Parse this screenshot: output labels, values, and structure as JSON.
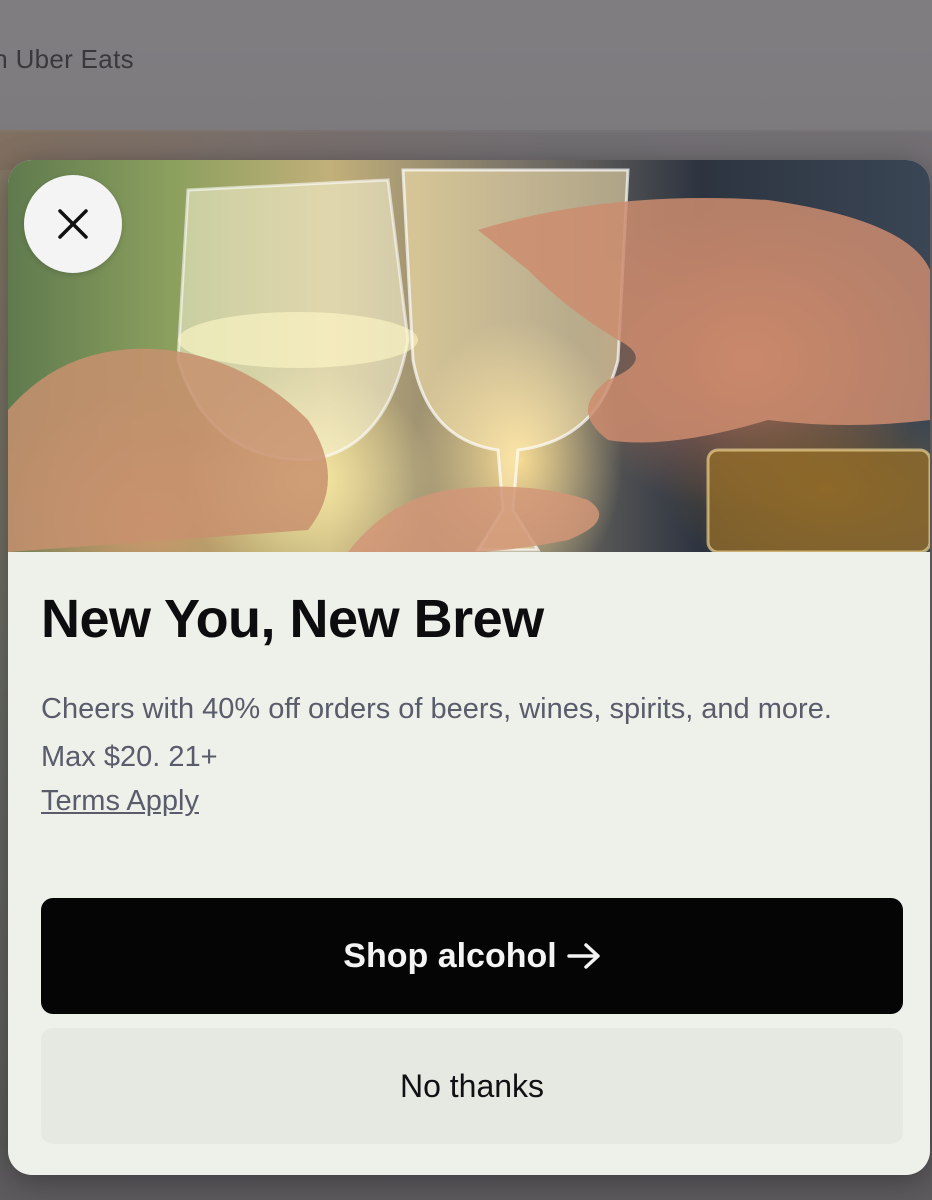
{
  "background": {
    "search_text": "ch Uber Eats"
  },
  "modal": {
    "close_icon": "close-icon",
    "hero_image": "people-toasting-drinks",
    "title": "New You, New Brew",
    "description": "Cheers with 40% off orders of beers, wines, spirits, and more. Max $20. 21+",
    "terms_link": "Terms Apply",
    "primary_button": "Shop alcohol",
    "primary_button_icon": "arrow-right-icon",
    "secondary_button": "No thanks"
  },
  "colors": {
    "primary_button_bg": "#050505",
    "modal_bg": "#eef1e9",
    "description_text": "#595c6b"
  }
}
